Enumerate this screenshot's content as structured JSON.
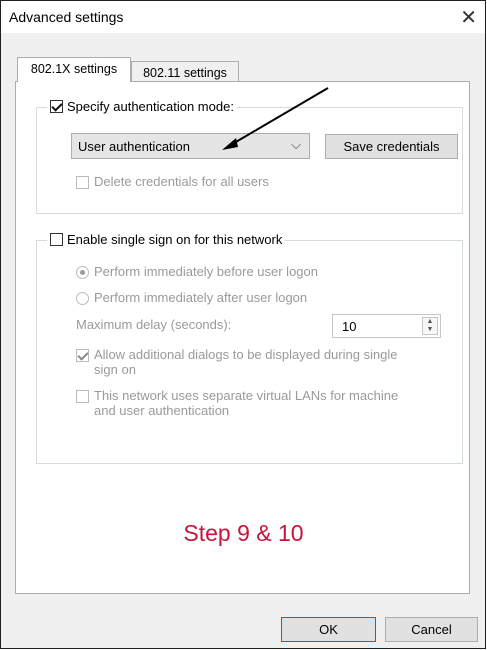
{
  "window": {
    "title": "Advanced settings",
    "close_glyph": "✕"
  },
  "tabs": [
    {
      "label": "802.1X settings",
      "active": true
    },
    {
      "label": "802.11 settings",
      "active": false
    }
  ],
  "auth_mode": {
    "checkbox_label": "Specify authentication mode:",
    "checked": true,
    "select_value": "User authentication",
    "chevron_glyph": "⌵",
    "save_label": "Save credentials",
    "delete_label": "Delete credentials for all users",
    "delete_checked": false
  },
  "sso": {
    "checkbox_label": "Enable single sign on for this network",
    "checked": false,
    "radio_before": "Perform immediately before user logon",
    "radio_after": "Perform immediately after user logon",
    "max_delay_label": "Maximum delay (seconds):",
    "max_delay_value": "10",
    "spin_up": "▲",
    "spin_down": "▼",
    "allow_dialogs_label_1": "Allow additional dialogs to be displayed during single",
    "allow_dialogs_label_2": "sign on",
    "allow_dialogs_checked": true,
    "vlan_label_1": "This network uses separate virtual LANs for machine",
    "vlan_label_2": "and user authentication",
    "vlan_checked": false
  },
  "annotation": {
    "text": "Step 9 & 10",
    "color": "#c8143c"
  },
  "footer": {
    "ok_label": "OK",
    "cancel_label": "Cancel"
  },
  "colors": {
    "background": "#f0f0f0",
    "panel": "#ffffff",
    "accent_border": "#0078d7"
  }
}
